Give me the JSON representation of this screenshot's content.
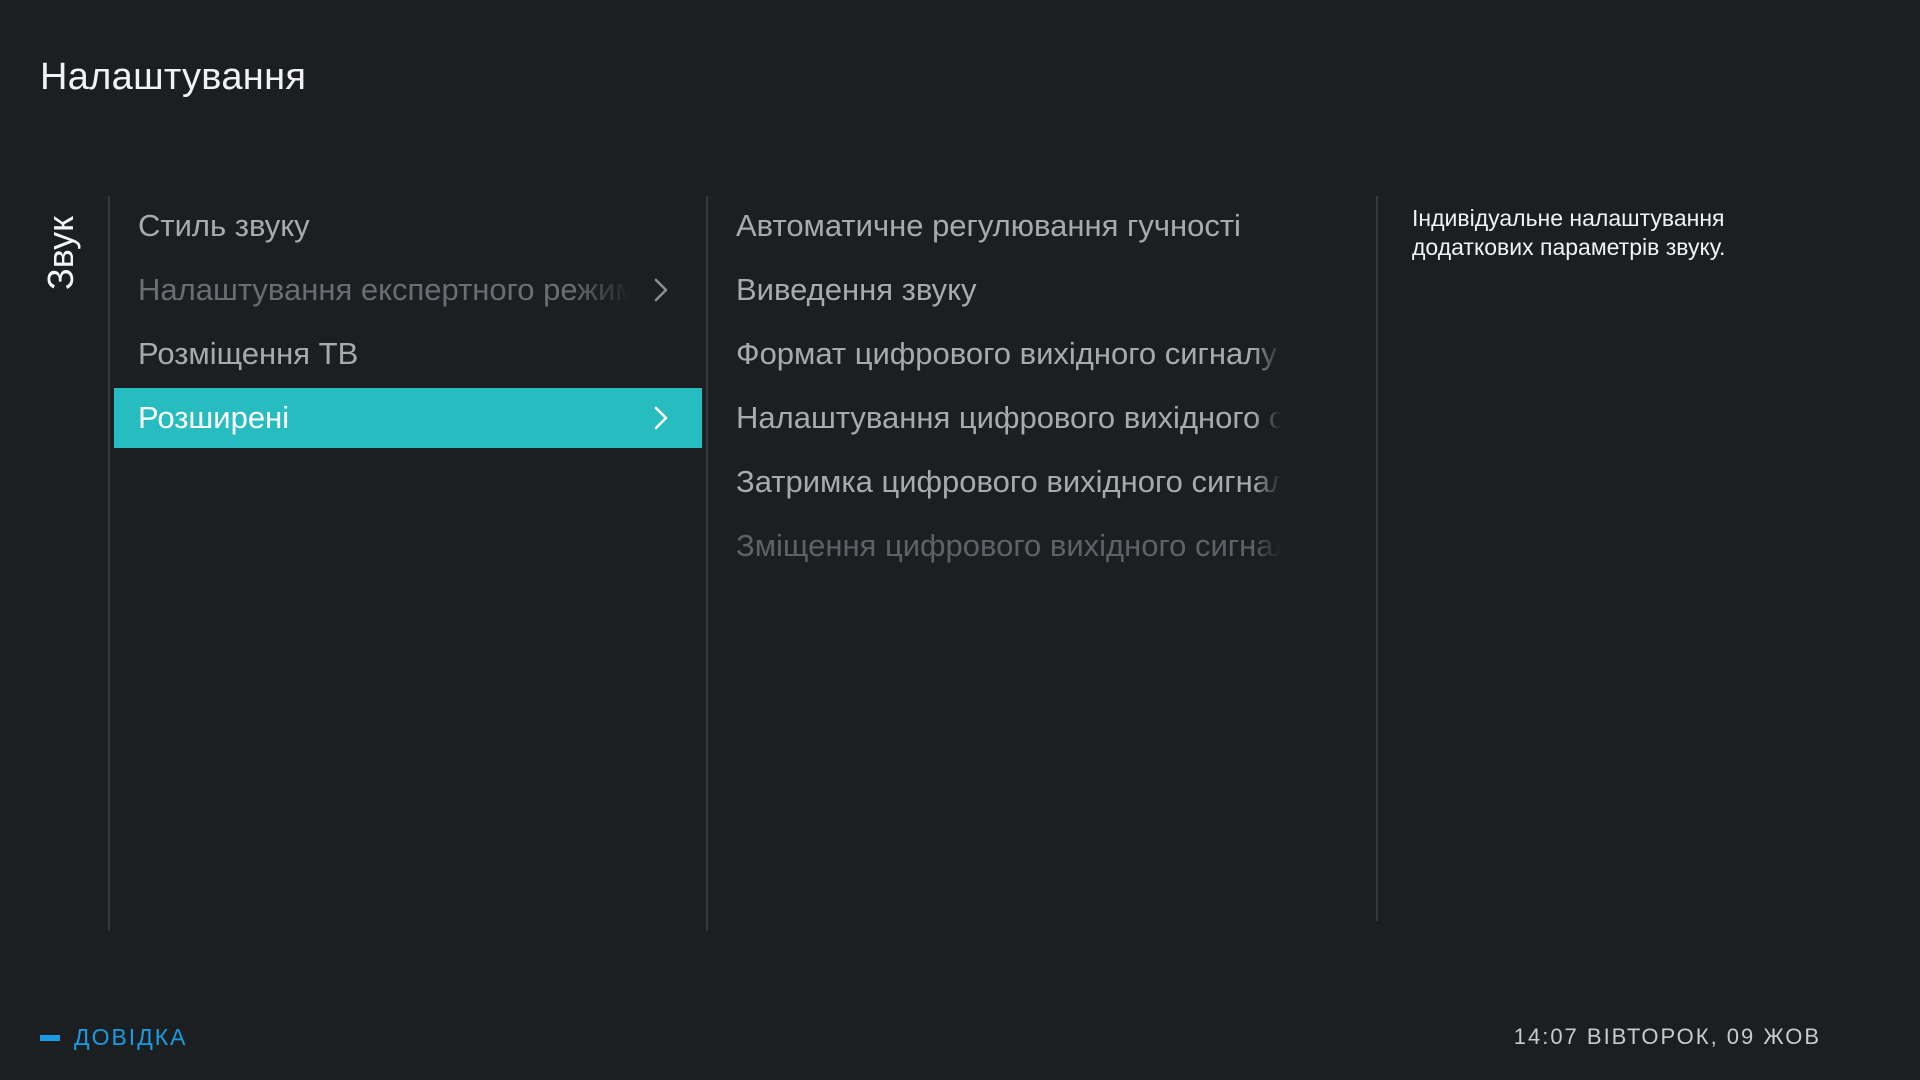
{
  "header": {
    "title": "Налаштування"
  },
  "section": {
    "label": "Звук"
  },
  "menu": {
    "items": [
      {
        "label": "Стиль звуку",
        "state": "normal",
        "has_submenu": false
      },
      {
        "label": "Налаштування експертного режиму",
        "state": "disabled",
        "has_submenu": true,
        "icon": "chevron-right-icon"
      },
      {
        "label": "Розміщення ТВ",
        "state": "normal",
        "has_submenu": false
      },
      {
        "label": "Розширені",
        "state": "selected",
        "has_submenu": true,
        "icon": "chevron-right-icon"
      }
    ]
  },
  "submenu": {
    "items": [
      {
        "label": "Автоматичне регулювання гучності",
        "state": "normal"
      },
      {
        "label": "Виведення звуку",
        "state": "normal"
      },
      {
        "label": "Формат цифрового вихідного сигналу",
        "state": "normal"
      },
      {
        "label": "Налаштування цифрового вихідного сигналу",
        "state": "normal"
      },
      {
        "label": "Затримка цифрового вихідного сигналу",
        "state": "normal"
      },
      {
        "label": "Зміщення цифрового вихідного сигналу",
        "state": "disabled"
      }
    ]
  },
  "description": {
    "line1": "Індивідуальне налаштування",
    "line2": "додаткових параметрів звуку."
  },
  "footer": {
    "help_label": "ДОВІДКА",
    "help_key_color": "#1a9be0",
    "clock": "14:07 ВІВТОРОК, 09 ЖОВ"
  },
  "colors": {
    "background": "#1c1f22",
    "accent": "#27bcbf",
    "text_primary": "#f2f2f2",
    "text_secondary": "#a8abae",
    "text_disabled": "#6a6e72"
  }
}
